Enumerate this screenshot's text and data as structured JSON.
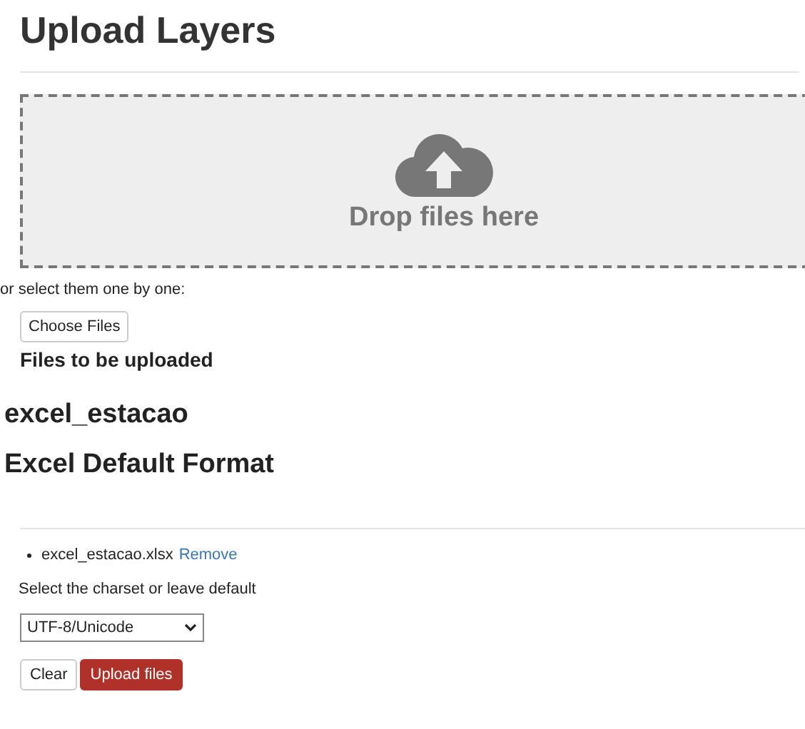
{
  "title": "Upload Layers",
  "dropzone": {
    "label": "Drop files here"
  },
  "select_hint": "or select them one by one:",
  "choose_button": "Choose Files",
  "files_heading": "Files to be uploaded",
  "layer_name": "excel_estacao",
  "format_heading": "Excel Default Format",
  "files": [
    {
      "name": "excel_estacao.xlsx",
      "action": "Remove"
    }
  ],
  "charset_label": "Select the charset or leave default",
  "charset": {
    "value": "UTF-8/Unicode"
  },
  "buttons": [
    {
      "label": "Clear",
      "kind": "default"
    },
    {
      "label": "Upload files",
      "kind": "primary"
    }
  ]
}
